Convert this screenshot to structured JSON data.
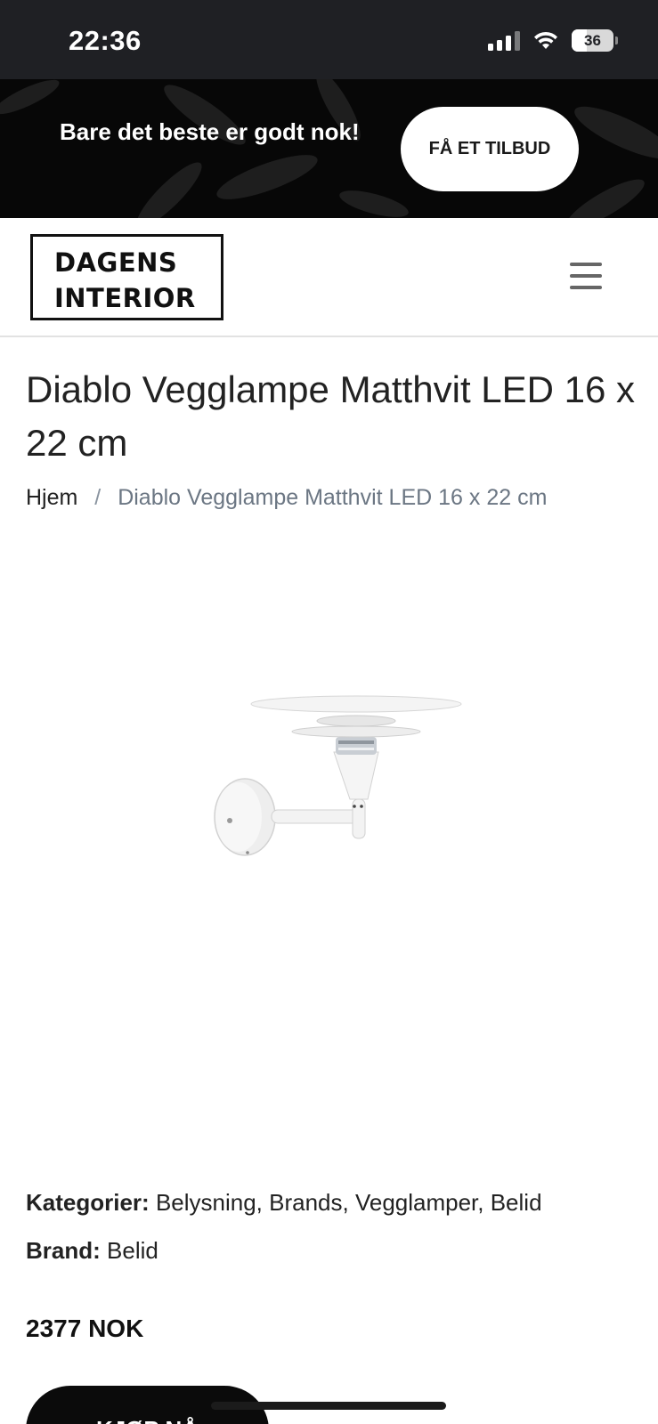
{
  "status_bar": {
    "time": "22:36",
    "battery_level": "36",
    "icons": [
      "cellular-signal-icon",
      "wifi-icon",
      "battery-icon"
    ]
  },
  "promo": {
    "text": "Bare det beste er godt nok!",
    "button_label": "FÅ ET TILBUD"
  },
  "header": {
    "logo_line1": "DAGENS",
    "logo_line2": "INTERIOR",
    "menu_icon": "hamburger-menu-icon"
  },
  "product": {
    "title": "Diablo Vegglampe Matthvit LED 16 x 22 cm",
    "image_icon": "wall-lamp-product-image",
    "categories_label": "Kategorier:",
    "categories_value": "Belysning, Brands, Vegglamper, Belid",
    "brand_label": "Brand:",
    "brand_value": "Belid",
    "price": "2377 NOK",
    "buy_label": "KJØP NÅ"
  },
  "breadcrumb": {
    "home": "Hjem",
    "separator": "/",
    "current": "Diablo Vegglampe Matthvit LED 16 x 22 cm"
  },
  "colors": {
    "status_bar_bg": "#1f2024",
    "promo_bg": "#070707",
    "button_dark": "#0b0b0b",
    "breadcrumb_current": "#6b7683"
  }
}
